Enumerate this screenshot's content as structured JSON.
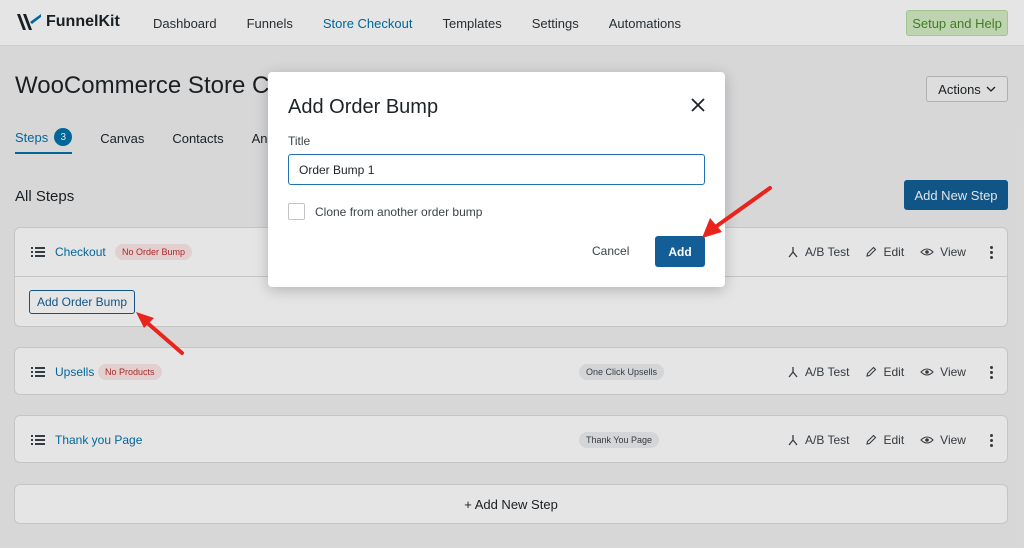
{
  "brand": {
    "name": "FunnelKit"
  },
  "nav": {
    "items": [
      {
        "label": "Dashboard"
      },
      {
        "label": "Funnels"
      },
      {
        "label": "Store Checkout"
      },
      {
        "label": "Templates"
      },
      {
        "label": "Settings"
      },
      {
        "label": "Automations"
      }
    ],
    "setup_label": "Setup and Help"
  },
  "page": {
    "title": "WooCommerce Store Cl",
    "actions_label": "Actions",
    "tabs": [
      {
        "label": "Steps",
        "badge": "3"
      },
      {
        "label": "Canvas"
      },
      {
        "label": "Contacts"
      },
      {
        "label": "Analyti"
      }
    ],
    "all_steps": "All Steps",
    "add_new_step_label": "Add New Step",
    "bottom_add_label": "+ Add New Step"
  },
  "steps": [
    {
      "name": "Checkout",
      "status": "No Order Bump",
      "type": "",
      "add_bump_label": "Add Order Bump"
    },
    {
      "name": "Upsells",
      "status": "No Products",
      "type": "One Click Upsells"
    },
    {
      "name": "Thank you Page",
      "status": "",
      "type": "Thank You Page"
    }
  ],
  "row_actions": {
    "ab_test": "A/B Test",
    "edit": "Edit",
    "view": "View"
  },
  "modal": {
    "title": "Add Order Bump",
    "field_label": "Title",
    "input_value": "Order Bump 1",
    "checkbox_label": "Clone from another order bump",
    "cancel_label": "Cancel",
    "add_label": "Add"
  },
  "colors": {
    "primary": "#135e96",
    "link": "#0073aa",
    "danger": "#c02b2b",
    "annotation_arrow": "#e8241c"
  }
}
